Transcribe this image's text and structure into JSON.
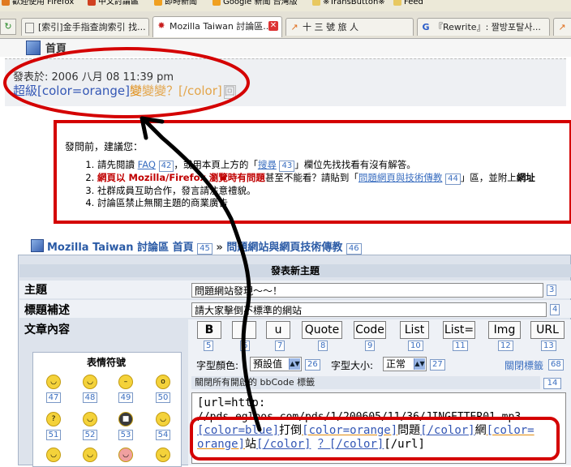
{
  "bookmarks": [
    {
      "label": "歡迎使用 Firefox"
    },
    {
      "label": "中文討論區"
    },
    {
      "label": "即時新聞"
    },
    {
      "label": "Google 新聞 台灣版"
    },
    {
      "label": "※TransButton※"
    },
    {
      "label": "Feed"
    }
  ],
  "tabs": [
    {
      "label": "[索引]金手指查詢索引 找..."
    },
    {
      "label": "Mozilla Taiwan 討論區..."
    },
    {
      "label": "十 三 號 旅 人"
    },
    {
      "label": "『Rewrite』: 짤방포탈사..."
    }
  ],
  "crumb_top": {
    "label": "首頁"
  },
  "post": {
    "date": "發表於: 2006 八月 08 11:39 pm",
    "body_a": "超級",
    "body_b": "[color=orange]",
    "body_c": "變",
    "body_d": "變變？[/color]",
    "body_e": "回"
  },
  "notice": {
    "heading": "發問前，建議您：",
    "i1_a": "請先閱讀 ",
    "i1_faq": "FAQ",
    "i1_faq_n": "42",
    "i1_b": "，或用本頁上方的「",
    "i1_search": "搜尋",
    "i1_search_n": "43",
    "i1_c": "」欄位先找找看有沒有解答。",
    "i2_a": "網頁以 Mozilla/Firefox 瀏覽時有問題",
    "i2_b": "甚至不能看？請貼到「",
    "i2_link": "問題網頁與技術傳教",
    "i2_n": "44",
    "i2_c": "」區，並附上",
    "i2_d": "網址",
    "i3": "社群成員互助合作，發言請注意禮貌。",
    "i4": "討論區禁止無關主題的商業廣告"
  },
  "nav": {
    "home": "Mozilla Taiwan 討論區 首頁",
    "home_n": "45",
    "sep": "»",
    "forum": "問題網站與網頁技術傳教",
    "forum_n": "46"
  },
  "form": {
    "heading": "發表新主題",
    "subject_label": "主題",
    "subject_value": "問題網站發現～～！",
    "subject_n": "3",
    "desc_label": "標題補述",
    "desc_value": "請大家擊倒不標準的網站",
    "desc_n": "4",
    "body_label": "文章內容",
    "buttons": [
      {
        "label": "B",
        "n": "5"
      },
      {
        "label": "i",
        "n": "6"
      },
      {
        "label": "u",
        "n": "7"
      },
      {
        "label": "Quote",
        "n": "8"
      },
      {
        "label": "Code",
        "n": "9"
      },
      {
        "label": "List",
        "n": "10"
      },
      {
        "label": "List=",
        "n": "11"
      },
      {
        "label": "Img",
        "n": "12"
      },
      {
        "label": "URL",
        "n": "13"
      }
    ],
    "font_color_label": "字型顏色:",
    "font_color_value": "預設值",
    "font_color_n": "26",
    "font_size_label": "字型大小:",
    "font_size_value": "正常",
    "font_size_n": "27",
    "close_tags": "關閉標籤",
    "close_tags_n": "68",
    "close_all": "關閉所有開啟的 bbCode 標籤",
    "close_all_n": "14",
    "smilies_title": "表情符號",
    "smilies": [
      "47",
      "48",
      "49",
      "50",
      "51",
      "52",
      "53",
      "54"
    ],
    "text_l1": "[url=http:",
    "text_l2": "//pds.egloos.com/pds/1/200605/11/36/JINGETTER01.mp3",
    "text_l3a": "[color=blue]",
    "text_l3b": "打倒",
    "text_l3c": "[color=orange]",
    "text_l3d": "問題",
    "text_l3e": "[/color]",
    "text_l3f": "網",
    "text_l3g": "[color=",
    "text_l4a": "orange]",
    "text_l4b": "站",
    "text_l4c": "[/color]",
    "text_l4d": "？[/color]",
    "text_l4e": "[/url]"
  },
  "colors": {
    "annotation_red": "#d40000",
    "link_blue": "#3a6ec0",
    "accent_orange": "#e08b10"
  }
}
